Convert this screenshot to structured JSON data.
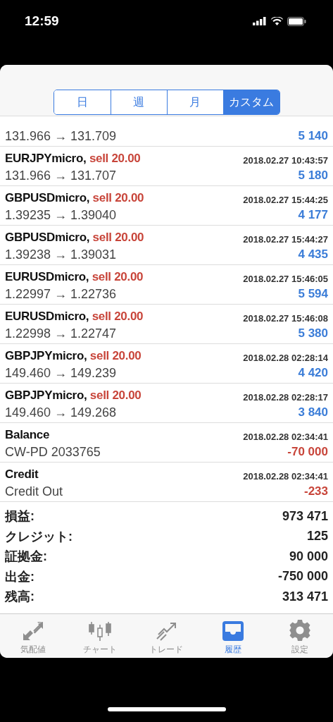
{
  "status_bar": {
    "time": "12:59"
  },
  "period_tabs": [
    {
      "label": "日",
      "selected": false
    },
    {
      "label": "週",
      "selected": false
    },
    {
      "label": "月",
      "selected": false
    },
    {
      "label": "カスタム",
      "selected": true
    }
  ],
  "rows": [
    {
      "kind": "partial",
      "prices": "131.966 → 131.709",
      "amount": "5 140",
      "color": "#3b7dd8"
    },
    {
      "kind": "trade",
      "symbol": "EURJPYmicro,",
      "side": "sell 20.00",
      "time": "2018.02.27 10:43:57",
      "prices": "131.966 → 131.707",
      "amount": "5 180",
      "color": "#3b7dd8"
    },
    {
      "kind": "trade",
      "symbol": "GBPUSDmicro,",
      "side": "sell 20.00",
      "time": "2018.02.27 15:44:25",
      "prices": "1.39235 → 1.39040",
      "amount": "4 177",
      "color": "#3b7dd8"
    },
    {
      "kind": "trade",
      "symbol": "GBPUSDmicro,",
      "side": "sell 20.00",
      "time": "2018.02.27 15:44:27",
      "prices": "1.39238 → 1.39031",
      "amount": "4 435",
      "color": "#3b7dd8"
    },
    {
      "kind": "trade",
      "symbol": "EURUSDmicro,",
      "side": "sell 20.00",
      "time": "2018.02.27 15:46:05",
      "prices": "1.22997 → 1.22736",
      "amount": "5 594",
      "color": "#3b7dd8"
    },
    {
      "kind": "trade",
      "symbol": "EURUSDmicro,",
      "side": "sell 20.00",
      "time": "2018.02.27 15:46:08",
      "prices": "1.22998 → 1.22747",
      "amount": "5 380",
      "color": "#3b7dd8"
    },
    {
      "kind": "trade",
      "symbol": "GBPJPYmicro,",
      "side": "sell 20.00",
      "time": "2018.02.28 02:28:14",
      "prices": "149.460 → 149.239",
      "amount": "4 420",
      "color": "#3b7dd8"
    },
    {
      "kind": "trade",
      "symbol": "GBPJPYmicro,",
      "side": "sell 20.00",
      "time": "2018.02.28 02:28:17",
      "prices": "149.460 → 149.268",
      "amount": "3 840",
      "color": "#3b7dd8"
    },
    {
      "kind": "balance",
      "symbol": "Balance",
      "time": "2018.02.28 02:34:41",
      "prices": "CW-PD 2033765",
      "amount": "-70 000",
      "color": "#c8453a"
    },
    {
      "kind": "balance",
      "symbol": "Credit",
      "time": "2018.02.28 02:34:41",
      "prices": "Credit Out",
      "amount": "-233",
      "color": "#c8453a"
    }
  ],
  "summary": [
    {
      "label": "損益:",
      "value": "973 471"
    },
    {
      "label": "クレジット:",
      "value": "125"
    },
    {
      "label": "証拠金:",
      "value": "90 000"
    },
    {
      "label": "出金:",
      "value": "-750 000"
    },
    {
      "label": "残高:",
      "value": "313 471"
    }
  ],
  "tab_bar": [
    {
      "label": "気配値",
      "kind": "quotes",
      "selected": false
    },
    {
      "label": "チャート",
      "kind": "chart",
      "selected": false
    },
    {
      "label": "トレード",
      "kind": "trade",
      "selected": false
    },
    {
      "label": "履歴",
      "kind": "history",
      "selected": true
    },
    {
      "label": "設定",
      "kind": "settings",
      "selected": false
    }
  ]
}
